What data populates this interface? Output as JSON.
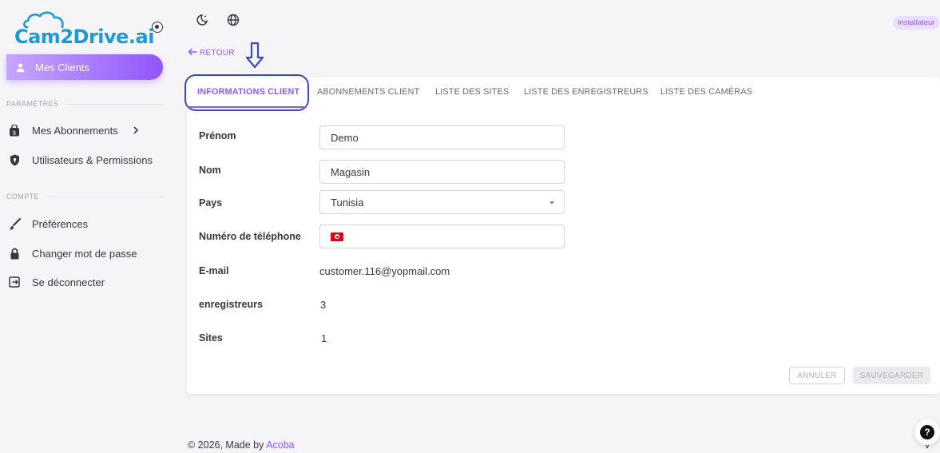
{
  "app": {
    "logo_text": "Cam2Drive.ai",
    "role_badge": "Installateur"
  },
  "sidebar": {
    "active_item": {
      "label": "Mes Clients",
      "icon": "person-icon"
    },
    "sections": [
      {
        "title": "PARAMÈTRES",
        "items": [
          {
            "label": "Mes Abonnements",
            "icon": "shopping-bag-icon",
            "has_chevron": true
          },
          {
            "label": "Utilisateurs & Permissions",
            "icon": "shield-icon"
          }
        ]
      },
      {
        "title": "COMPTE",
        "items": [
          {
            "label": "Préférences",
            "icon": "brush-icon"
          },
          {
            "label": "Changer mot de passe",
            "icon": "lock-icon"
          },
          {
            "label": "Se déconnecter",
            "icon": "logout-icon"
          }
        ]
      }
    ]
  },
  "topbar": {
    "icons": [
      "theme-toggle-icon",
      "language-globe-icon"
    ],
    "back_label": "RETOUR"
  },
  "tabs": [
    {
      "label": "INFORMATIONS CLIENT",
      "active": true
    },
    {
      "label": "ABONNEMENTS CLIENT",
      "active": false
    },
    {
      "label": "LISTE DES SITES",
      "active": false
    },
    {
      "label": "LISTE DES ENREGISTREURS",
      "active": false
    },
    {
      "label": "LISTE DES CAMÉRAS",
      "active": false
    }
  ],
  "form": {
    "prenom": {
      "label": "Prénom",
      "value": "Demo"
    },
    "nom": {
      "label": "Nom",
      "value": "Magasin"
    },
    "pays": {
      "label": "Pays",
      "value": "Tunisia"
    },
    "telephone": {
      "label": "Numéro de téléphone",
      "value": "",
      "flag": "tunisia-flag-icon"
    },
    "email": {
      "label": "E-mail",
      "value": "customer.116@yopmail.com"
    },
    "enregistreurs": {
      "label": "enregistreurs",
      "value": "3"
    },
    "sites": {
      "label": "Sites",
      "value": "1"
    }
  },
  "actions": {
    "cancel_label": "ANNULER",
    "save_label": "SAUVEGARDER"
  },
  "footer": {
    "copyright": "© 2026, Made by",
    "brand": "Acoba",
    "version": "v ..."
  },
  "colors": {
    "accent": "#9155fd",
    "logo": "#1a9ad6",
    "annotation": "#3b4cc0"
  }
}
